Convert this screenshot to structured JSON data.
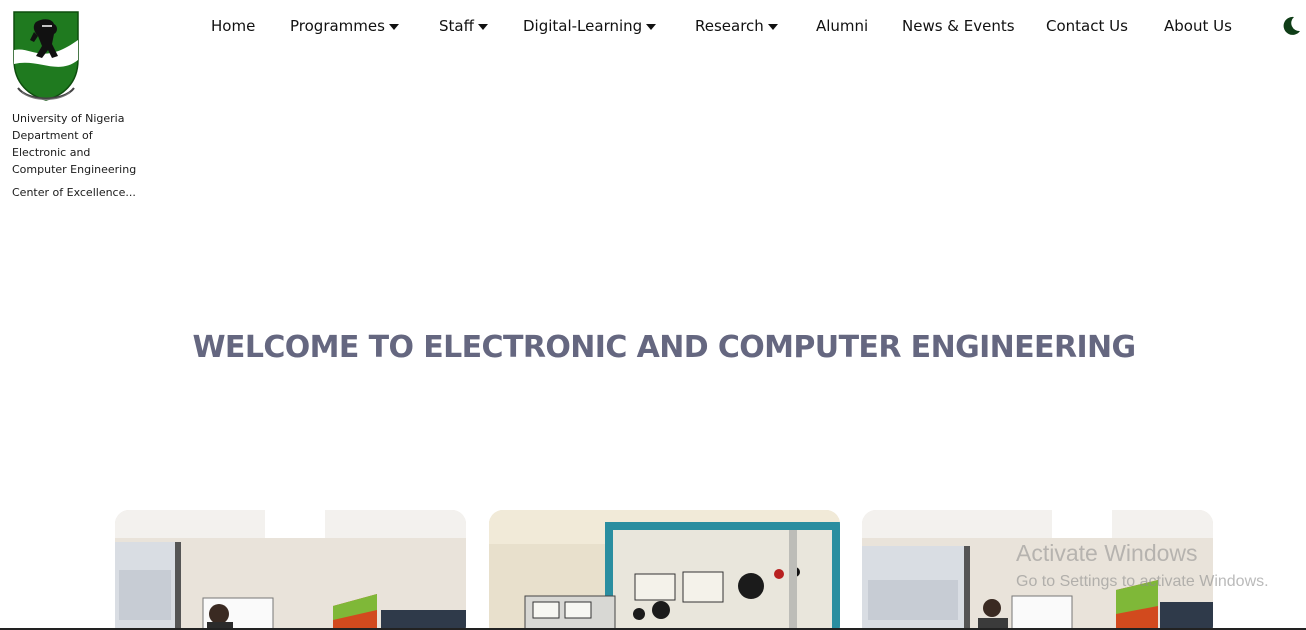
{
  "brand": {
    "lines": [
      "University of Nigeria",
      "Department of",
      "Electronic and",
      "Computer Engineering"
    ],
    "tagline": "Center of Excellence..."
  },
  "nav": {
    "items": [
      {
        "label": "Home",
        "dropdown": false
      },
      {
        "label": "Programmes",
        "dropdown": true
      },
      {
        "label": "Staff",
        "dropdown": true
      },
      {
        "label": "Digital-Learning",
        "dropdown": true
      },
      {
        "label": "Research",
        "dropdown": true
      },
      {
        "label": "Alumni",
        "dropdown": false
      },
      {
        "label": "News & Events",
        "dropdown": false
      },
      {
        "label": "Contact Us",
        "dropdown": false
      },
      {
        "label": "About Us",
        "dropdown": false
      }
    ],
    "theme_icon": "moon-icon"
  },
  "hero": {
    "title": "WELCOME TO ELECTRONIC AND COMPUTER ENGINEERING"
  },
  "cards": [
    {
      "image": "classroom-presentation-photo"
    },
    {
      "image": "lab-equipment-photo"
    },
    {
      "image": "classroom-presentation-photo"
    }
  ],
  "watermark": {
    "title": "Activate Windows",
    "subtitle": "Go to Settings to activate Windows."
  },
  "colors": {
    "brand_green": "#1f7a1f",
    "hero_title": "#656780",
    "moon": "#0f3d17"
  }
}
